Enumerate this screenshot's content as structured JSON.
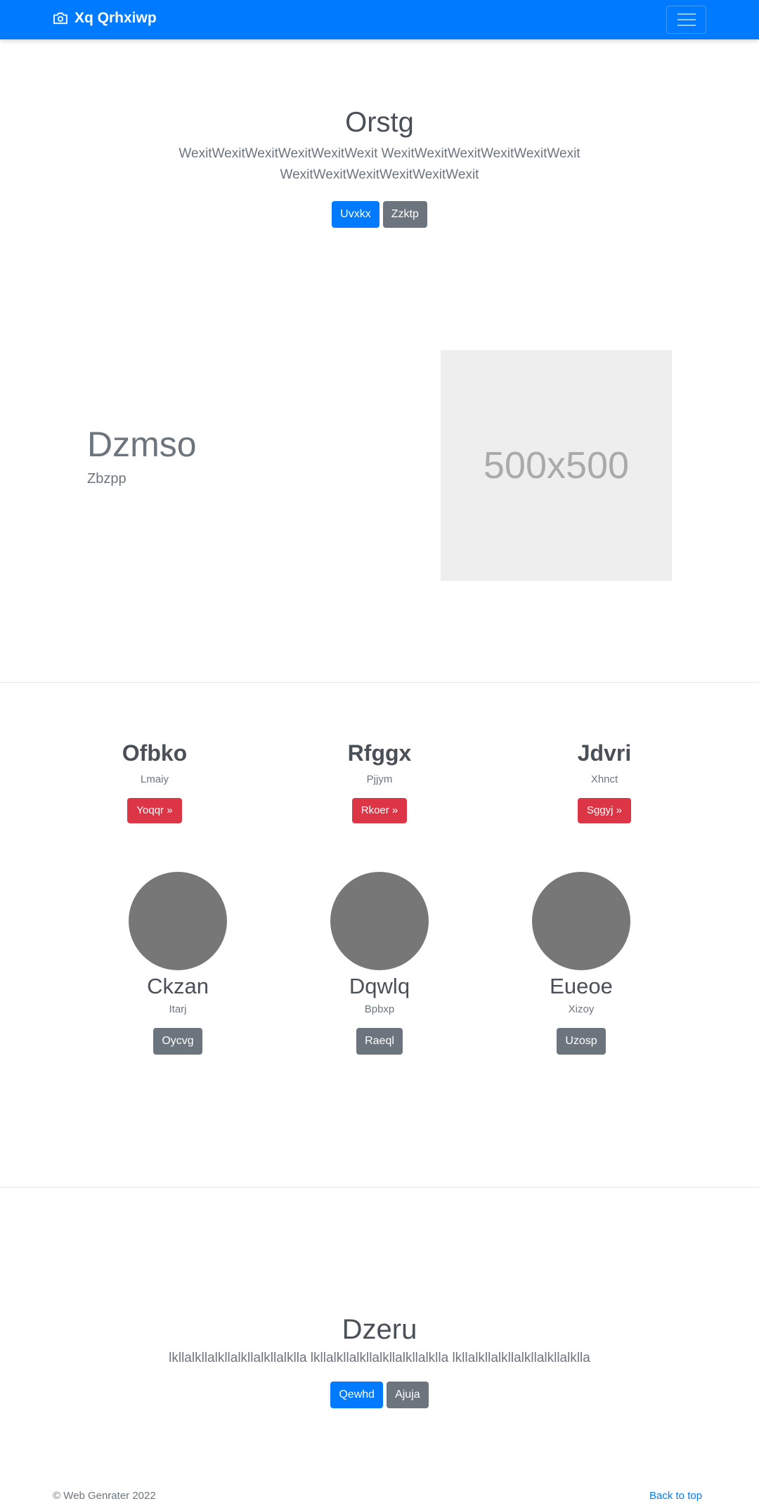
{
  "navbar": {
    "brand": "Xq Qrhxiwp",
    "brand_icon": "camera-icon",
    "toggler_icon": "hamburger-icon",
    "bg_color": "#007bff"
  },
  "hero": {
    "title": "Orstg",
    "lead": "WexitWexitWexitWexitWexitWexit WexitWexitWexitWexitWexitWexit WexitWexitWexitWexitWexitWexit",
    "primary_button": "Uvxkx",
    "secondary_button": "Zzktp"
  },
  "featurette": {
    "title": "Dzmso",
    "subtitle": "Zbzpp",
    "image_label": "500x500"
  },
  "columns": [
    {
      "title": "Ofbko",
      "text": "Lmaiy",
      "button": "Yoqqr »"
    },
    {
      "title": "Rfggx",
      "text": "Pjjym",
      "button": "Rkoer »"
    },
    {
      "title": "Jdvri",
      "text": "Xhnct",
      "button": "Sggyj »"
    }
  ],
  "circles": [
    {
      "title": "Ckzan",
      "text": "Itarj",
      "button": "Oycvg"
    },
    {
      "title": "Dqwlq",
      "text": "Bpbxp",
      "button": "Raeql"
    },
    {
      "title": "Eueoe",
      "text": "Xizoy",
      "button": "Uzosp"
    }
  ],
  "hero2": {
    "title": "Dzeru",
    "lead": "lkllalkllalkllalkllalkllalklla lkllalkllalkllalkllalkllalklla lkllalkllalkllalkllalkllalklla",
    "primary_button": "Qewhd",
    "secondary_button": "Ajuja"
  },
  "footer": {
    "copyright": "© Web Genrater 2022",
    "back_to_top": "Back to top"
  },
  "colors": {
    "primary": "#007bff",
    "secondary": "#6c757d",
    "danger": "#dc3545"
  }
}
